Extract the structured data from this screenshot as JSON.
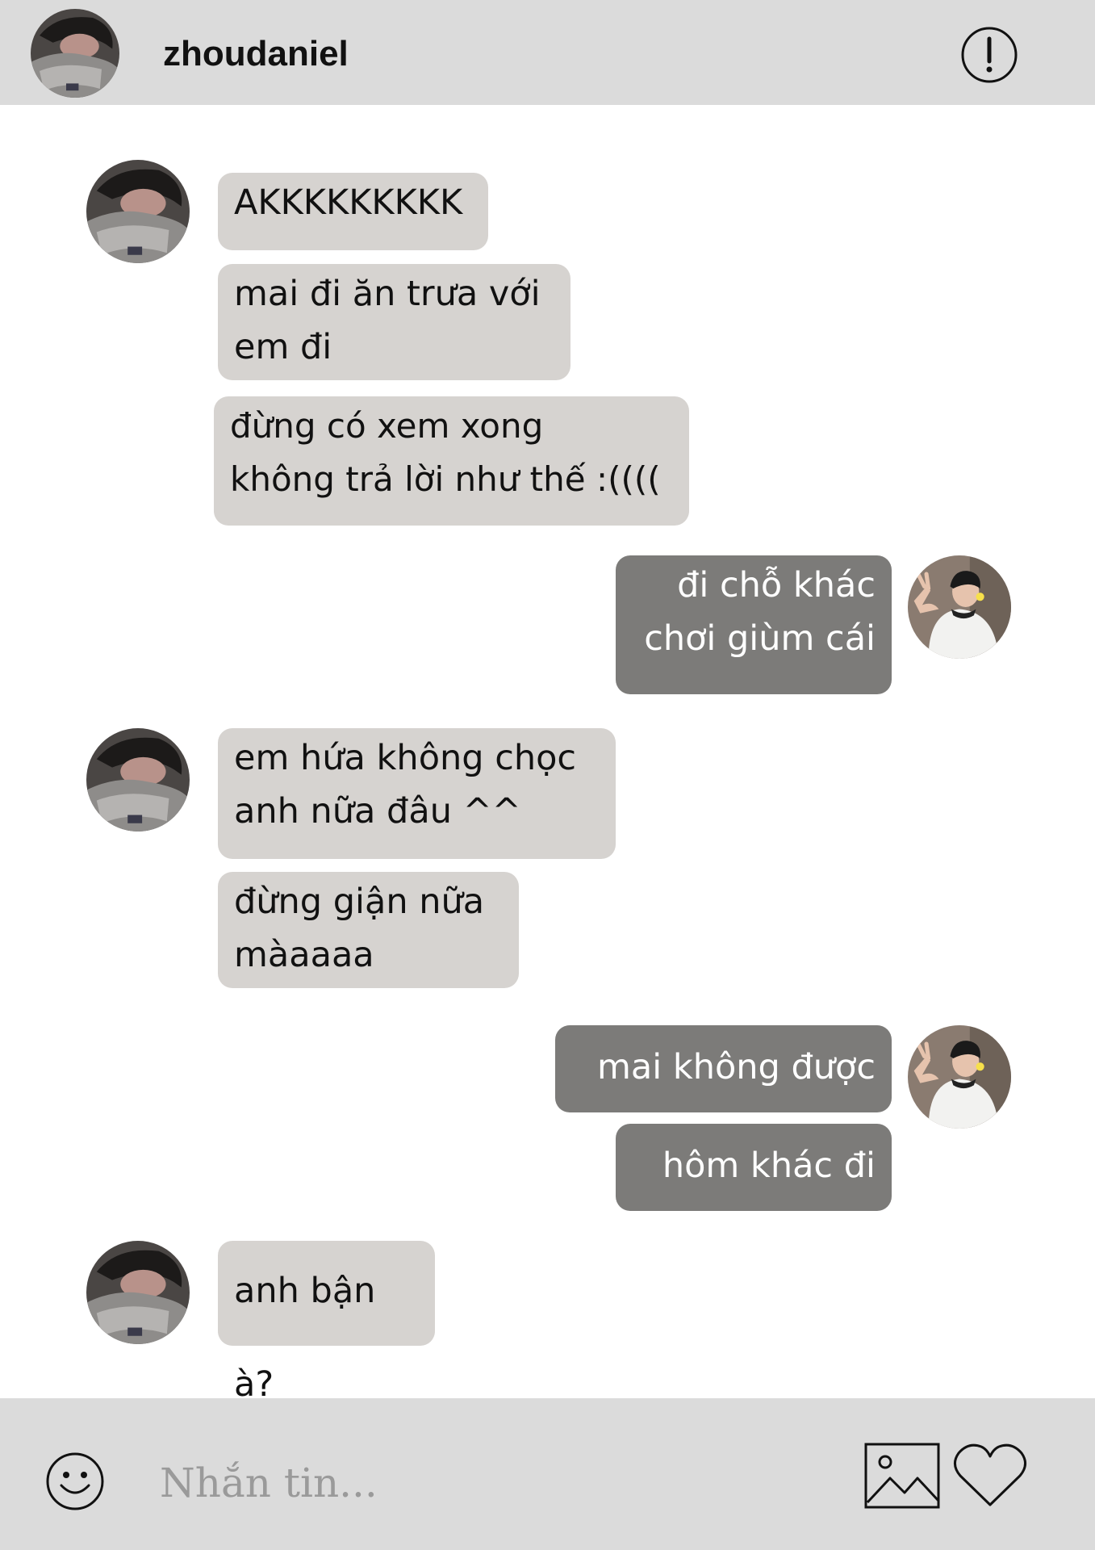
{
  "header": {
    "username": "zhoudaniel",
    "info_icon": "exclamation-circle-icon",
    "avatar_icon": "contact-avatar"
  },
  "messages": [
    {
      "from": "contact",
      "text": "AKKKKKKKKK"
    },
    {
      "from": "contact",
      "text": "mai đi ăn trưa với\nem đi"
    },
    {
      "from": "contact",
      "text": "đừng có xem xong\nkhông trả lời như thế :(((("
    },
    {
      "from": "me",
      "text": "đi chỗ khác\nchơi giùm cái"
    },
    {
      "from": "contact",
      "text": "em hứa không chọc\nanh nữa đâu ^^"
    },
    {
      "from": "contact",
      "text": "đừng giận nữa\nmàaaaa"
    },
    {
      "from": "me",
      "text": "mai không được"
    },
    {
      "from": "me",
      "text": "hôm khác đi"
    },
    {
      "from": "contact",
      "text": "anh bận à?"
    }
  ],
  "composer": {
    "placeholder": "Nhắn tin...",
    "emoji_icon": "smiley-icon",
    "image_icon": "image-icon",
    "like_icon": "heart-icon"
  },
  "colors": {
    "header_bg": "#dbdbdb",
    "incoming_bubble": "#d6d3d0",
    "outgoing_bubble": "#7c7b79",
    "outgoing_text": "#ffffff",
    "incoming_text": "#111111"
  }
}
